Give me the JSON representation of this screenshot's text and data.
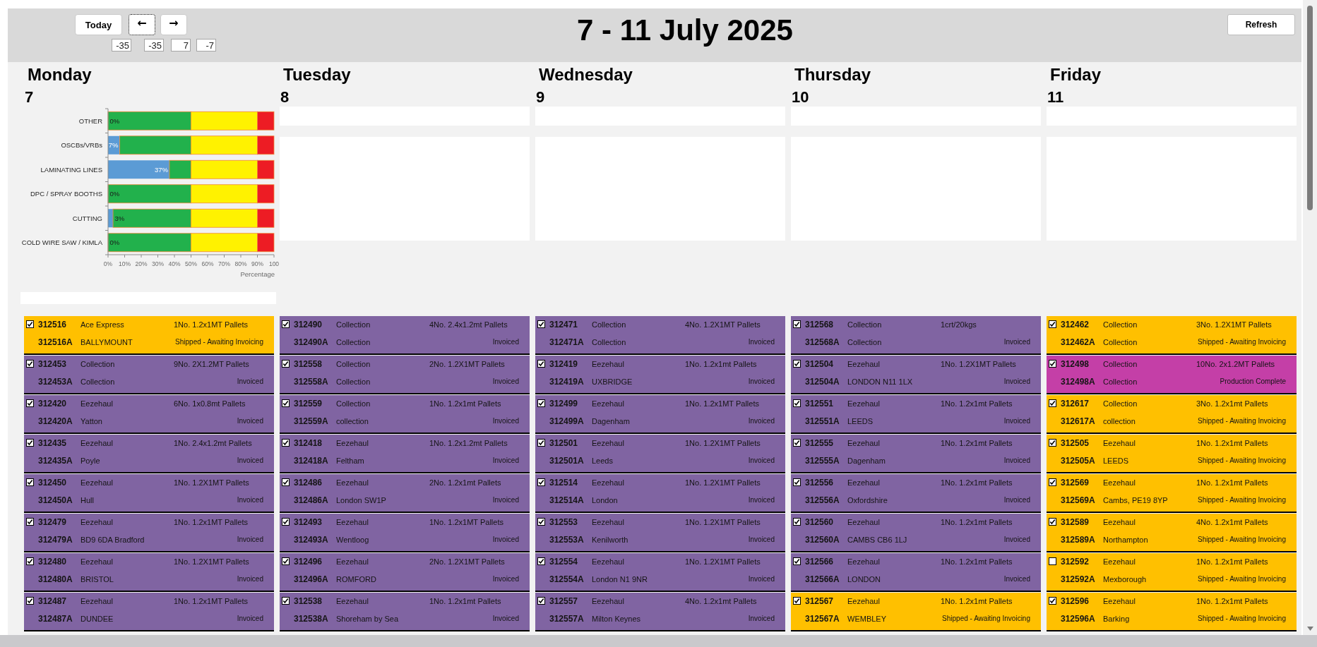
{
  "toolbar": {
    "nav_buttons": [
      {
        "label": "Today",
        "focused": false
      },
      {
        "label": "←",
        "focused": true
      },
      {
        "label": "→",
        "focused": false
      }
    ],
    "fields": [
      "-35",
      "-35",
      "7",
      "-7"
    ],
    "refresh_button": "Refresh"
  },
  "title": "7 - 11 July 2025",
  "days": [
    {
      "name": "Monday",
      "date": "7",
      "summary": {
        "kind": "chart",
        "chart_data": {
          "type": "bar",
          "orientation": "horizontal",
          "stacked": true,
          "xlabel": "Percentage",
          "categories": [
            "OTHER",
            "OSCBs/VRBs",
            "LAMINATING LINES",
            "DPC / SPRAY BOOTHS",
            "CUTTING",
            "COLD WIRE SAW / KIMLA"
          ],
          "series": [
            {
              "color": "#5b9bd5",
              "values": [
                0,
                7,
                37,
                0,
                3,
                0
              ]
            },
            {
              "color": "#22b14c",
              "values": [
                50,
                43,
                13,
                50,
                47,
                50
              ]
            },
            {
              "color": "#fff200",
              "values": [
                40,
                40,
                40,
                40,
                40,
                40
              ]
            },
            {
              "color": "#ed1c24",
              "values": [
                10,
                10,
                10,
                10,
                10,
                10
              ]
            }
          ],
          "xlim": [
            0,
            100
          ],
          "xticks": [
            {
              "value": 0,
              "label": "0%"
            },
            {
              "value": 10,
              "label": "10%"
            },
            {
              "value": 20,
              "label": "20%"
            },
            {
              "value": 30,
              "label": "30%"
            },
            {
              "value": 40,
              "label": "40%"
            },
            {
              "value": 50,
              "label": "50%"
            },
            {
              "value": 60,
              "label": "60%"
            },
            {
              "value": 70,
              "label": "70%"
            },
            {
              "value": 80,
              "label": "80%"
            },
            {
              "value": 90,
              "label": "90%"
            },
            {
              "value": 100,
              "label": "100"
            }
          ],
          "value_labels": [
            "0%",
            "7%",
            "37%",
            "0%",
            "3%",
            "0%"
          ]
        }
      },
      "orders": [
        {
          "order": "312516",
          "carrier": "Ace Express",
          "pallets": "1No. 1.2x1MT Pallets",
          "ref": "312516A",
          "destination": "BALLYMOUNT",
          "status": "Shipped - Awaiting Invoicing",
          "checked": true,
          "color": "#ffc000"
        },
        {
          "order": "312453",
          "carrier": "Collection",
          "pallets": "9No. 2X1.2MT Pallets",
          "ref": "312453A",
          "destination": "Collection",
          "status": "Invoiced",
          "checked": true,
          "color": "#8064a2"
        },
        {
          "order": "312420",
          "carrier": "Eezehaul",
          "pallets": "6No. 1x0.8mt Pallets",
          "ref": "312420A",
          "destination": "Yatton",
          "status": "Invoiced",
          "checked": true,
          "color": "#8064a2"
        },
        {
          "order": "312435",
          "carrier": "Eezehaul",
          "pallets": "1No. 2.4x1.2mt Pallets",
          "ref": "312435A",
          "destination": "Poyle",
          "status": "Invoiced",
          "checked": true,
          "color": "#8064a2"
        },
        {
          "order": "312450",
          "carrier": "Eezehaul",
          "pallets": "1No. 1.2X1MT Pallets",
          "ref": "312450A",
          "destination": "Hull",
          "status": "Invoiced",
          "checked": true,
          "color": "#8064a2"
        },
        {
          "order": "312479",
          "carrier": "Eezehaul",
          "pallets": "1No. 1.2x1MT Pallets",
          "ref": "312479A",
          "destination": "BD9 6DA Bradford",
          "status": "Invoiced",
          "checked": true,
          "color": "#8064a2"
        },
        {
          "order": "312480",
          "carrier": "Eezehaul",
          "pallets": "1No. 1.2X1MT Pallets",
          "ref": "312480A",
          "destination": "BRISTOL",
          "status": "Invoiced",
          "checked": true,
          "color": "#8064a2"
        },
        {
          "order": "312487",
          "carrier": "Eezehaul",
          "pallets": "1No. 1.2x1MT Pallets",
          "ref": "312487A",
          "destination": "DUNDEE",
          "status": "Invoiced",
          "checked": true,
          "color": "#8064a2"
        }
      ]
    },
    {
      "name": "Tuesday",
      "date": "8",
      "summary": {
        "kind": "blank"
      },
      "orders": [
        {
          "order": "312490",
          "carrier": "Collection",
          "pallets": "4No. 2.4x1.2mt Pallets",
          "ref": "312490A",
          "destination": "Collection",
          "status": "Invoiced",
          "checked": true,
          "color": "#8064a2"
        },
        {
          "order": "312558",
          "carrier": "Collection",
          "pallets": "2No. 1.2X1MT Pallets",
          "ref": "312558A",
          "destination": "Collection",
          "status": "Invoiced",
          "checked": true,
          "color": "#8064a2"
        },
        {
          "order": "312559",
          "carrier": "Collection",
          "pallets": "1No. 1.2x1mt Pallets",
          "ref": "312559A",
          "destination": "collection",
          "status": "Invoiced",
          "checked": true,
          "color": "#8064a2"
        },
        {
          "order": "312418",
          "carrier": "Eezehaul",
          "pallets": "1No. 1.2x1.2mt Pallets",
          "ref": "312418A",
          "destination": "Feltham",
          "status": "Invoiced",
          "checked": true,
          "color": "#8064a2"
        },
        {
          "order": "312486",
          "carrier": "Eezehaul",
          "pallets": "2No. 1.2x1mt Pallets",
          "ref": "312486A",
          "destination": "London SW1P",
          "status": "Invoiced",
          "checked": true,
          "color": "#8064a2"
        },
        {
          "order": "312493",
          "carrier": "Eezehaul",
          "pallets": "1No. 1.2x1MT Pallets",
          "ref": "312493A",
          "destination": "Wentloog",
          "status": "Invoiced",
          "checked": true,
          "color": "#8064a2"
        },
        {
          "order": "312496",
          "carrier": "Eezehaul",
          "pallets": "2No. 1.2X1MT Pallets",
          "ref": "312496A",
          "destination": "ROMFORD",
          "status": "Invoiced",
          "checked": true,
          "color": "#8064a2"
        },
        {
          "order": "312538",
          "carrier": "Eezehaul",
          "pallets": "1No. 1.2x1mt Pallets",
          "ref": "312538A",
          "destination": "Shoreham by Sea",
          "status": "Invoiced",
          "checked": true,
          "color": "#8064a2"
        }
      ]
    },
    {
      "name": "Wednesday",
      "date": "9",
      "summary": {
        "kind": "blank"
      },
      "orders": [
        {
          "order": "312471",
          "carrier": "Collection",
          "pallets": "4No. 1.2X1MT Pallets",
          "ref": "312471A",
          "destination": "Collection",
          "status": "Invoiced",
          "checked": true,
          "color": "#8064a2"
        },
        {
          "order": "312419",
          "carrier": "Eezehaul",
          "pallets": "1No. 1.2x1mt Pallets",
          "ref": "312419A",
          "destination": "UXBRIDGE",
          "status": "Invoiced",
          "checked": true,
          "color": "#8064a2"
        },
        {
          "order": "312499",
          "carrier": "Eezehaul",
          "pallets": "1No. 1.2x1MT Pallets",
          "ref": "312499A",
          "destination": "Dagenham",
          "status": "Invoiced",
          "checked": true,
          "color": "#8064a2"
        },
        {
          "order": "312501",
          "carrier": "Eezehaul",
          "pallets": "1No. 1.2X1MT Pallets",
          "ref": "312501A",
          "destination": "Leeds",
          "status": "Invoiced",
          "checked": true,
          "color": "#8064a2"
        },
        {
          "order": "312514",
          "carrier": "Eezehaul",
          "pallets": "1No. 1.2X1MT Pallets",
          "ref": "312514A",
          "destination": "London",
          "status": "Invoiced",
          "checked": true,
          "color": "#8064a2"
        },
        {
          "order": "312553",
          "carrier": "Eezehaul",
          "pallets": "1No. 1.2X1MT Pallets",
          "ref": "312553A",
          "destination": "Kenilworth",
          "status": "Invoiced",
          "checked": true,
          "color": "#8064a2"
        },
        {
          "order": "312554",
          "carrier": "Eezehaul",
          "pallets": "1No. 1.2X1MT Pallets",
          "ref": "312554A",
          "destination": "London N1 9NR",
          "status": "Invoiced",
          "checked": true,
          "color": "#8064a2"
        },
        {
          "order": "312557",
          "carrier": "Eezehaul",
          "pallets": "4No. 1.2x1mt Pallets",
          "ref": "312557A",
          "destination": "Milton Keynes",
          "status": "Invoiced",
          "checked": true,
          "color": "#8064a2"
        }
      ]
    },
    {
      "name": "Thursday",
      "date": "10",
      "summary": {
        "kind": "blank"
      },
      "orders": [
        {
          "order": "312568",
          "carrier": "Collection",
          "pallets": "1crt/20kgs",
          "ref": "312568A",
          "destination": "Collection",
          "status": "Invoiced",
          "checked": true,
          "color": "#8064a2"
        },
        {
          "order": "312504",
          "carrier": "Eezehaul",
          "pallets": "1No. 1.2X1MT Pallets",
          "ref": "312504A",
          "destination": "LONDON N11 1LX",
          "status": "Invoiced",
          "checked": true,
          "color": "#8064a2"
        },
        {
          "order": "312551",
          "carrier": "Eezehaul",
          "pallets": "1No. 1.2x1mt Pallets",
          "ref": "312551A",
          "destination": "LEEDS",
          "status": "Invoiced",
          "checked": true,
          "color": "#8064a2"
        },
        {
          "order": "312555",
          "carrier": "Eezehaul",
          "pallets": "1No. 1.2x1mt Pallets",
          "ref": "312555A",
          "destination": "Dagenham",
          "status": "Invoiced",
          "checked": true,
          "color": "#8064a2"
        },
        {
          "order": "312556",
          "carrier": "Eezehaul",
          "pallets": "1No. 1.2x1mt Pallets",
          "ref": "312556A",
          "destination": "Oxfordshire",
          "status": "Invoiced",
          "checked": true,
          "color": "#8064a2"
        },
        {
          "order": "312560",
          "carrier": "Eezehaul",
          "pallets": "1No. 1.2x1mt Pallets",
          "ref": "312560A",
          "destination": "CAMBS CB6 1LJ",
          "status": "Invoiced",
          "checked": true,
          "color": "#8064a2"
        },
        {
          "order": "312566",
          "carrier": "Eezehaul",
          "pallets": "1No. 1.2x1mt Pallets",
          "ref": "312566A",
          "destination": "LONDON",
          "status": "Invoiced",
          "checked": true,
          "color": "#8064a2"
        },
        {
          "order": "312567",
          "carrier": "Eezehaul",
          "pallets": "1No. 1.2x1mt Pallets",
          "ref": "312567A",
          "destination": "WEMBLEY",
          "status": "Shipped - Awaiting Invoicing",
          "checked": true,
          "color": "#ffc000"
        }
      ]
    },
    {
      "name": "Friday",
      "date": "11",
      "summary": {
        "kind": "blank"
      },
      "orders": [
        {
          "order": "312462",
          "carrier": "Collection",
          "pallets": "3No. 1.2X1MT Pallets",
          "ref": "312462A",
          "destination": "Collection",
          "status": "Shipped - Awaiting Invoicing",
          "checked": true,
          "color": "#ffc000"
        },
        {
          "order": "312498",
          "carrier": "Collection",
          "pallets": "10No. 2x1.2MT Pallets",
          "ref": "312498A",
          "destination": "Collection",
          "status": "Production Complete",
          "checked": true,
          "color": "#c43fa7"
        },
        {
          "order": "312617",
          "carrier": "Collection",
          "pallets": "3No. 1.2x1mt Pallets",
          "ref": "312617A",
          "destination": "collection",
          "status": "Shipped - Awaiting Invoicing",
          "checked": true,
          "color": "#ffc000"
        },
        {
          "order": "312505",
          "carrier": "Eezehaul",
          "pallets": "1No. 1.2x1mt Pallets",
          "ref": "312505A",
          "destination": "LEEDS",
          "status": "Shipped - Awaiting Invoicing",
          "checked": true,
          "color": "#ffc000"
        },
        {
          "order": "312569",
          "carrier": "Eezehaul",
          "pallets": "1No. 1.2x1mt Pallets",
          "ref": "312569A",
          "destination": "Cambs, PE19 8YP",
          "status": "Shipped - Awaiting Invoicing",
          "checked": true,
          "color": "#ffc000"
        },
        {
          "order": "312589",
          "carrier": "Eezehaul",
          "pallets": "4No. 1.2x1mt Pallets",
          "ref": "312589A",
          "destination": "Northampton",
          "status": "Shipped - Awaiting Invoicing",
          "checked": true,
          "color": "#ffc000"
        },
        {
          "order": "312592",
          "carrier": "Eezehaul",
          "pallets": "1No. 1.2x1mt Pallets",
          "ref": "312592A",
          "destination": "Mexborough",
          "status": "Shipped - Awaiting Invoicing",
          "checked": false,
          "color": "#ffc000"
        },
        {
          "order": "312596",
          "carrier": "Eezehaul",
          "pallets": "1No. 1.2x1mt Pallets",
          "ref": "312596A",
          "destination": "Barking",
          "status": "Shipped - Awaiting Invoicing",
          "checked": true,
          "color": "#ffc000"
        }
      ]
    }
  ]
}
